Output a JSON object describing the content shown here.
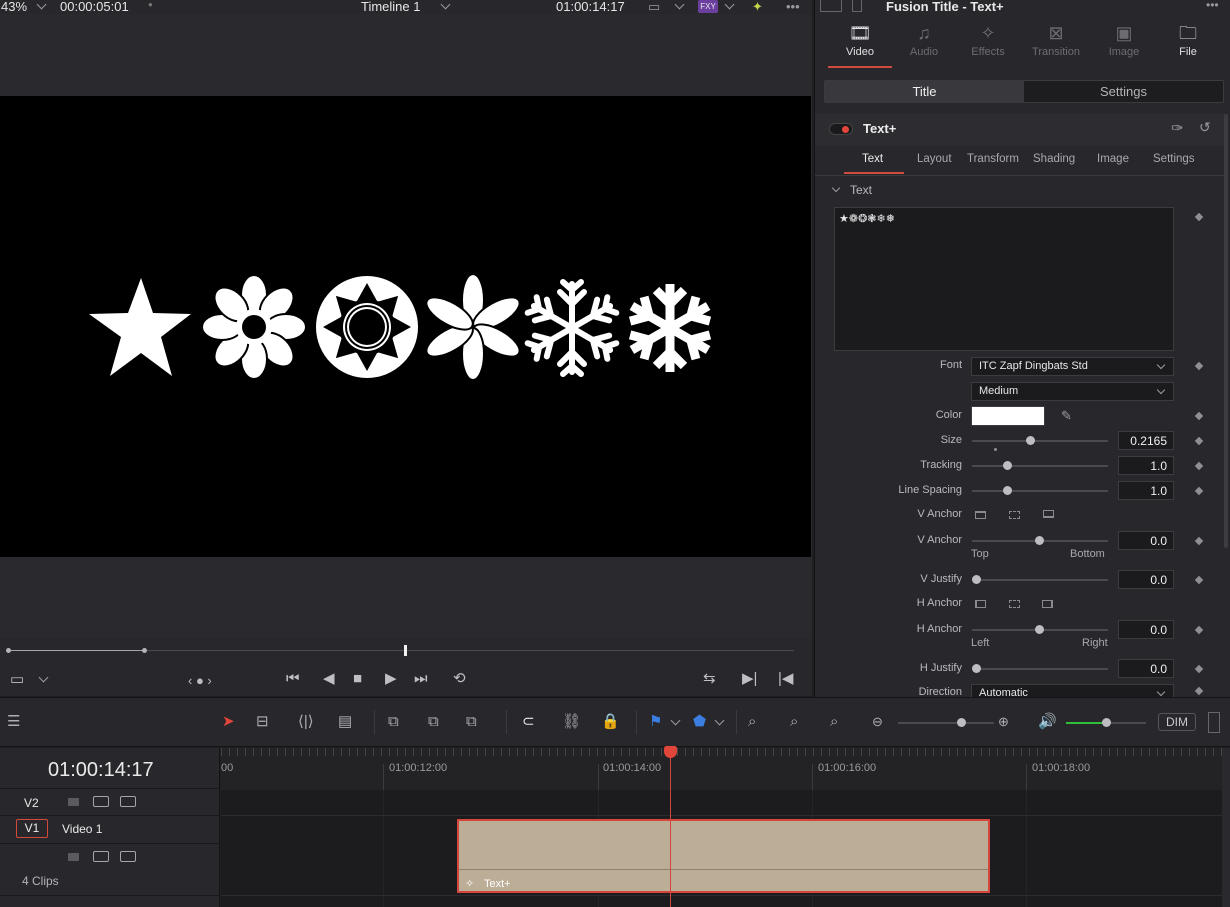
{
  "viewer": {
    "zoom": "43%",
    "duration": "00:00:05:01",
    "timeline_name": "Timeline 1",
    "timecode": "01:00:14:17",
    "frame_glyphs": "★❁❂❃❄❅",
    "transport_nav": "‹ ● ›"
  },
  "inspector": {
    "title": "Fusion Title - Text+",
    "tabs": [
      {
        "label": "Video",
        "icon": "film-icon"
      },
      {
        "label": "Audio",
        "icon": "music-note-icon"
      },
      {
        "label": "Effects",
        "icon": "magic-wand-icon"
      },
      {
        "label": "Transition",
        "icon": "transition-icon"
      },
      {
        "label": "Image",
        "icon": "image-icon"
      },
      {
        "label": "File",
        "icon": "file-icon"
      }
    ],
    "segment": {
      "title": "Title",
      "settings": "Settings"
    },
    "effect_name": "Text+",
    "subtabs": [
      "Text",
      "Layout",
      "Transform",
      "Shading",
      "Image",
      "Settings"
    ],
    "section_text": "Text",
    "text_content": "★❁❂❃❄❅",
    "font_label": "Font",
    "font_value": "ITC Zapf Dingbats Std",
    "style_value": "Medium",
    "color_label": "Color",
    "color_value": "#ffffff",
    "size_label": "Size",
    "size_value": "0.2165",
    "tracking_label": "Tracking",
    "tracking_value": "1.0",
    "line_spacing_label": "Line Spacing",
    "line_spacing_value": "1.0",
    "v_anchor_label": "V Anchor",
    "v_anchor_value": "0.0",
    "v_anchor_left": "Top",
    "v_anchor_right": "Bottom",
    "v_justify_label": "V Justify",
    "v_justify_value": "0.0",
    "h_anchor_label": "H Anchor",
    "h_anchor_value": "0.0",
    "h_anchor_left": "Left",
    "h_anchor_right": "Right",
    "h_justify_label": "H Justify",
    "h_justify_value": "0.0",
    "direction_label": "Direction",
    "direction_value": "Automatic"
  },
  "timeline": {
    "timecode": "01:00:14:17",
    "tracks": [
      {
        "id": "V2",
        "name": ""
      },
      {
        "id": "V1",
        "name": "Video 1"
      }
    ],
    "clips_count": "4 Clips",
    "ruler_labels": [
      "00",
      "01:00:12:00",
      "01:00:14:00",
      "01:00:16:00",
      "01:00:18:00"
    ],
    "clip_label": "Text+",
    "dim_label": "DIM"
  },
  "colors": {
    "accent": "#d24a3c",
    "clip": "#bcae96",
    "volume": "#2fbf3a"
  }
}
